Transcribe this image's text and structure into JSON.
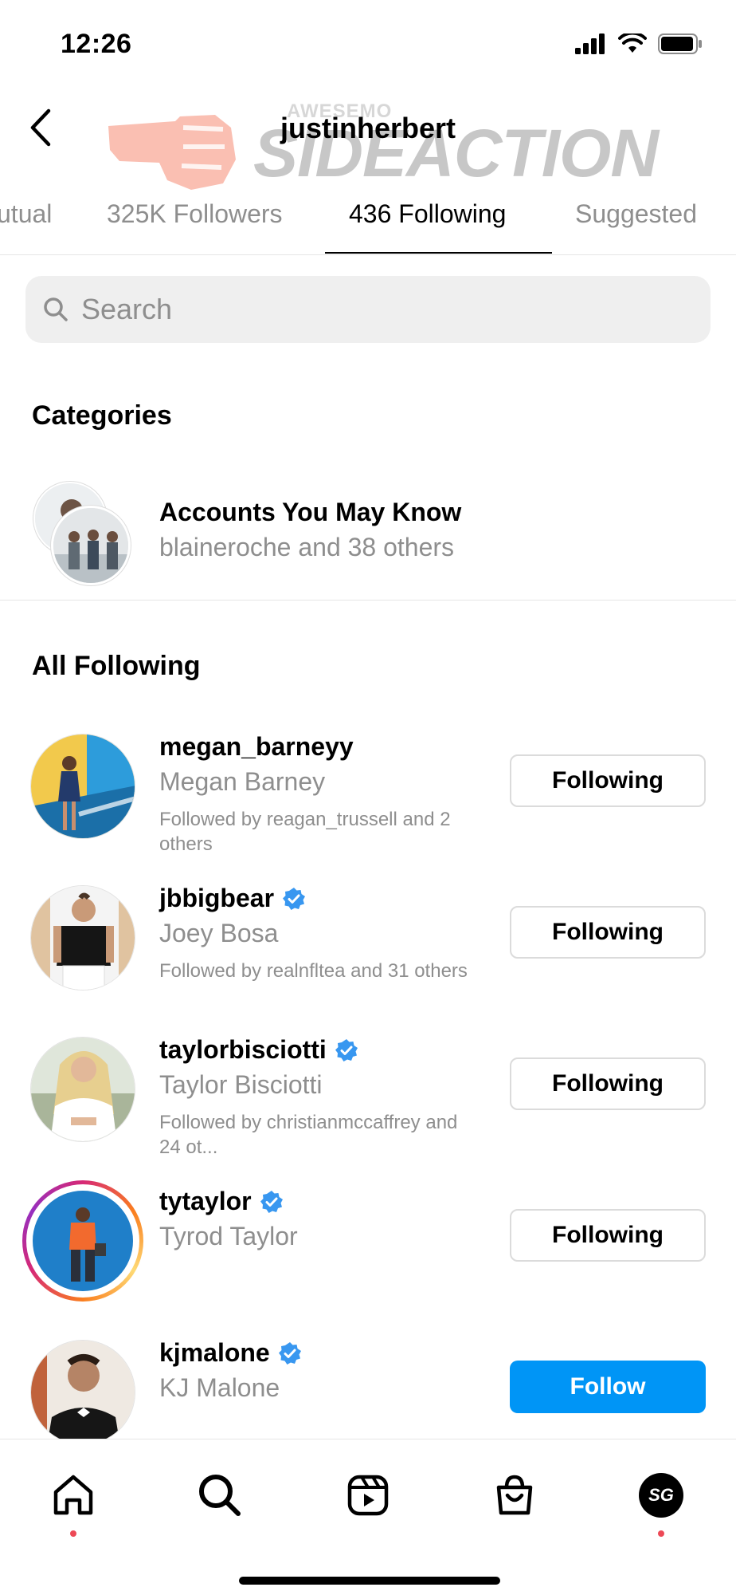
{
  "status_bar": {
    "time": "12:26"
  },
  "header": {
    "username": "justinherbert",
    "watermark_small": "AWESEMO",
    "watermark_big": "SIDEACTION"
  },
  "tabs": [
    {
      "label": "utual"
    },
    {
      "label": "325K Followers"
    },
    {
      "label": "436 Following",
      "active": true
    },
    {
      "label": "Suggested"
    }
  ],
  "search": {
    "placeholder": "Search"
  },
  "categories": {
    "title": "Categories",
    "item": {
      "title": "Accounts You May Know",
      "subtitle": "blaineroche and 38 others"
    }
  },
  "following": {
    "title": "All Following",
    "rows": [
      {
        "handle": "megan_barneyy",
        "name": "Megan Barney",
        "meta": "Followed by reagan_trussell and 2 others",
        "verified": false,
        "button": "Following"
      },
      {
        "handle": "jbbigbear",
        "name": "Joey Bosa",
        "meta": "Followed by realnfltea and 31 others",
        "verified": true,
        "button": "Following"
      },
      {
        "handle": "taylorbisciotti",
        "name": "Taylor Bisciotti",
        "meta": "Followed by christianmccaffrey and 24 ot...",
        "verified": true,
        "button": "Following"
      },
      {
        "handle": "tytaylor",
        "name": "Tyrod Taylor",
        "meta": "",
        "verified": true,
        "story_ring": true,
        "button": "Following"
      },
      {
        "handle": "kjmalone",
        "name": "KJ Malone",
        "meta": "",
        "verified": true,
        "button": "Follow"
      }
    ]
  },
  "bottom_nav": {
    "items": [
      "home-icon",
      "search-icon",
      "reels-icon",
      "shop-icon",
      "profile-avatar"
    ],
    "profile_initials": "SG"
  },
  "colors": {
    "follow_blue": "#0095f6",
    "verified_blue": "#3897f0",
    "secondary_text": "#8e8e8e",
    "notification_red": "#ed4956"
  }
}
